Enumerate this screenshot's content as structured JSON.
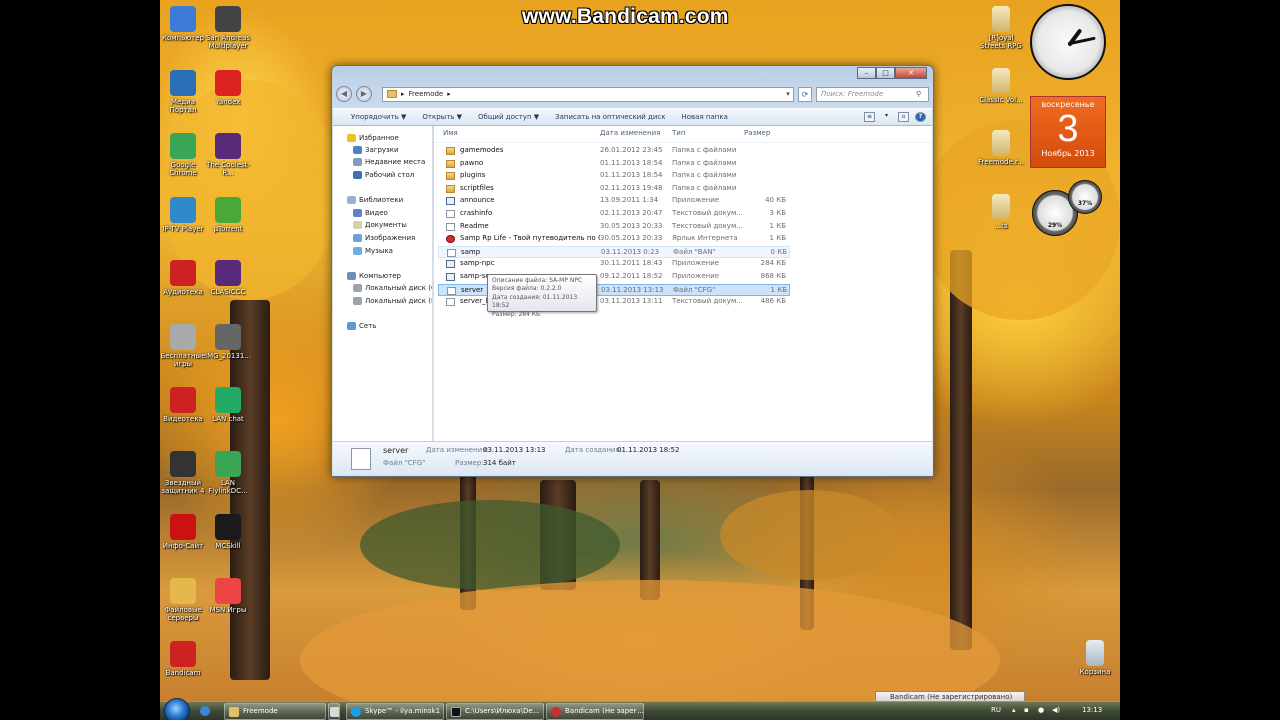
{
  "watermark": "www.Bandicam.com",
  "desktop_icons_left": [
    {
      "label": "Компьютер",
      "icon": "computer-icon"
    },
    {
      "label": "San Andreas Multiplayer",
      "icon": "samp-icon"
    },
    {
      "label": "Медиа Портал",
      "icon": "media-portal-icon"
    },
    {
      "label": "Yandex",
      "icon": "yandex-icon"
    },
    {
      "label": "Google Chrome",
      "icon": "chrome-icon"
    },
    {
      "label": "The Coolest-R...",
      "icon": "archive-icon"
    },
    {
      "label": "IP-TV Player",
      "icon": "iptv-icon"
    },
    {
      "label": "µTorrent",
      "icon": "utorrent-icon"
    },
    {
      "label": "Аудиотека",
      "icon": "audiotheque-icon"
    },
    {
      "label": "CLASICCC",
      "icon": "archive-icon"
    },
    {
      "label": "Бесплатные игры",
      "icon": "free-games-icon"
    },
    {
      "label": "IMG_20131...",
      "icon": "image-icon"
    },
    {
      "label": "Видеотека",
      "icon": "videotheque-icon"
    },
    {
      "label": "LAN chat",
      "icon": "lan-chat-icon"
    },
    {
      "label": "Звездный защитник 4",
      "icon": "star-defender-icon"
    },
    {
      "label": "LAN FlylinkDC...",
      "icon": "flylink-icon"
    },
    {
      "label": "Инфо-Сайт",
      "icon": "opera-icon"
    },
    {
      "label": "MCSkill",
      "icon": "mcskill-icon"
    },
    {
      "label": "Файловые серверы",
      "icon": "file-servers-icon"
    },
    {
      "label": "MSN Игры",
      "icon": "msn-games-icon"
    },
    {
      "label": "Bandicam",
      "icon": "bandicam-icon"
    }
  ],
  "desktop_icons_right": [
    {
      "label": "[R]oyal Streets RPG",
      "icon": "folder-zip-icon"
    },
    {
      "label": "Classic Vol...",
      "icon": "folder-zip-icon"
    },
    {
      "label": "Freemode.r...",
      "icon": "folder-zip-icon"
    },
    {
      "label": "...ts",
      "icon": "folder-zip-icon"
    },
    {
      "label": "Корзина",
      "icon": "recycle-bin-icon"
    }
  ],
  "gadgets": {
    "calendar": {
      "weekday": "воскресенье",
      "day": "3",
      "month": "Ноябрь 2013"
    },
    "clock": {
      "hour": 1,
      "minute": 13
    },
    "cpu_gauges": [
      "29%",
      "37%"
    ]
  },
  "window": {
    "breadcrumb": "Freemode",
    "search_placeholder": "Поиск: Freemode",
    "toolbar": {
      "organize": "Упорядочить ▼",
      "open": "Открыть ▼",
      "share": "Общий доступ ▼",
      "burn": "Записать на оптический диск",
      "new_folder": "Новая папка"
    },
    "nav": [
      {
        "label": "Избранное",
        "indent": 0
      },
      {
        "label": "Загрузки",
        "indent": 1
      },
      {
        "label": "Недавние места",
        "indent": 1
      },
      {
        "label": "Рабочий стол",
        "indent": 1
      },
      {
        "label": "Библиотеки",
        "indent": 0
      },
      {
        "label": "Видео",
        "indent": 1
      },
      {
        "label": "Документы",
        "indent": 1
      },
      {
        "label": "Изображения",
        "indent": 1
      },
      {
        "label": "Музыка",
        "indent": 1
      },
      {
        "label": "Компьютер",
        "indent": 0
      },
      {
        "label": "Локальный диск (C:)",
        "indent": 1
      },
      {
        "label": "Локальный диск (D:)",
        "indent": 1
      },
      {
        "label": "Сеть",
        "indent": 0
      }
    ],
    "columns": {
      "name": "Имя",
      "date": "Дата изменения",
      "type": "Тип",
      "size": "Размер"
    },
    "files": [
      {
        "name": "gamemodes",
        "date": "26.01.2012 23:45",
        "type": "Папка с файлами",
        "size": "",
        "kind": "folder"
      },
      {
        "name": "pawno",
        "date": "01.11.2013 18:54",
        "type": "Папка с файлами",
        "size": "",
        "kind": "folder"
      },
      {
        "name": "plugins",
        "date": "01.11.2013 18:54",
        "type": "Папка с файлами",
        "size": "",
        "kind": "folder"
      },
      {
        "name": "scriptfiles",
        "date": "02.11.2013 19:48",
        "type": "Папка с файлами",
        "size": "",
        "kind": "folder"
      },
      {
        "name": "announce",
        "date": "13.09.2011 1:34",
        "type": "Приложение",
        "size": "40 КБ",
        "kind": "app"
      },
      {
        "name": "crashinfo",
        "date": "02.11.2013 20:47",
        "type": "Текстовый докум...",
        "size": "3 КБ",
        "kind": "file"
      },
      {
        "name": "Readme",
        "date": "30.05.2013 20:33",
        "type": "Текстовый докум...",
        "size": "1 КБ",
        "kind": "file"
      },
      {
        "name": "Samp Rp Life - Твой путеводитель по G...",
        "date": "30.05.2013 20:33",
        "type": "Ярлык Интернета",
        "size": "1 КБ",
        "kind": "url"
      },
      {
        "name": "samp",
        "date": "03.11.2013 0:23",
        "type": "Файл \"BAN\"",
        "size": "0 КБ",
        "kind": "file"
      },
      {
        "name": "samp-npc",
        "date": "30.11.2011 18:43",
        "type": "Приложение",
        "size": "284 КБ",
        "kind": "app"
      },
      {
        "name": "samp-server",
        "date": "09.12.2011 18:52",
        "type": "Приложение",
        "size": "868 КБ",
        "kind": "app"
      },
      {
        "name": "server",
        "date": "03.11.2013 13:13",
        "type": "Файл \"CFG\"",
        "size": "1 КБ",
        "kind": "file"
      },
      {
        "name": "server_log",
        "date": "03.11.2013 13:11",
        "type": "Текстовый докум...",
        "size": "486 КБ",
        "kind": "file"
      }
    ],
    "tooltip": [
      "Описание файла: SA-MP NPC",
      "Версия файла: 0.2.2.0",
      "Дата создания: 01.11.2013 18:52",
      "Размер: 284 КБ"
    ],
    "details": {
      "name": "server",
      "type": "Файл \"CFG\"",
      "modified_label": "Дата изменения:",
      "modified": "03.11.2013 13:13",
      "created_label": "Дата создания:",
      "created": "01.11.2013 18:52",
      "size_label": "Размер:",
      "size": "314 байт"
    }
  },
  "taskbar": {
    "items": [
      {
        "label": "Freemode",
        "icon": "folder-icon"
      },
      {
        "label": "Skype™ - ilya.minsk1",
        "icon": "skype-icon"
      },
      {
        "label": "C:\\Users\\Илюха\\De...",
        "icon": "cmd-icon"
      },
      {
        "label": "Bandicam (Не зарег...",
        "icon": "bandicam-icon"
      }
    ],
    "lang": "RU",
    "time": "13:13",
    "popup": "Bandicam (Не зарегистрировано)"
  },
  "colors": {
    "selection": "#cce3fb",
    "calendar": "#e85a15",
    "taskbar": "#3f4a35"
  }
}
